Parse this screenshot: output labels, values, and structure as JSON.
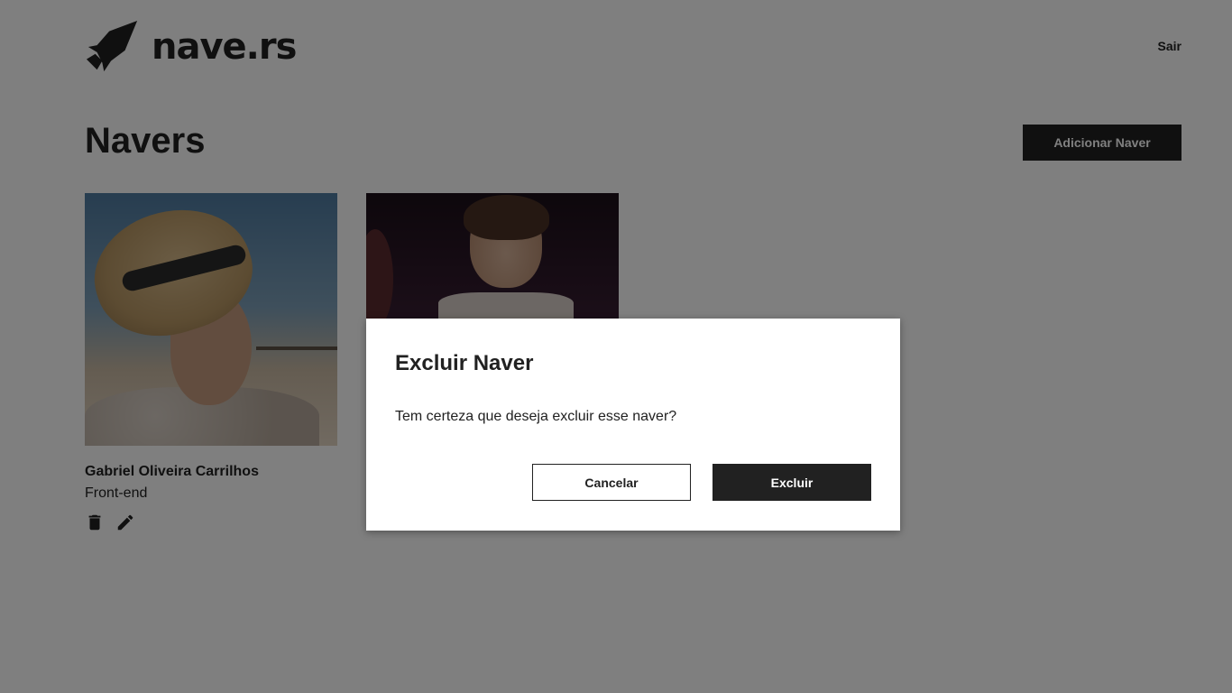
{
  "header": {
    "logo_text": "nave.rs",
    "logout_label": "Sair"
  },
  "main": {
    "title": "Navers",
    "add_button_label": "Adicionar Naver",
    "cards": [
      {
        "name": "Gabriel Oliveira Carrilhos",
        "role": "Front-end"
      },
      {
        "name": "",
        "role": ""
      }
    ]
  },
  "modal": {
    "title": "Excluir Naver",
    "message": "Tem certeza que deseja excluir esse naver?",
    "cancel_label": "Cancelar",
    "confirm_label": "Excluir"
  },
  "colors": {
    "primary": "#212121",
    "background": "#ffffff",
    "overlay": "rgba(0,0,0,0.5)"
  },
  "icons": {
    "logo": "rocket-icon",
    "delete": "trash-icon",
    "edit": "pencil-icon"
  }
}
